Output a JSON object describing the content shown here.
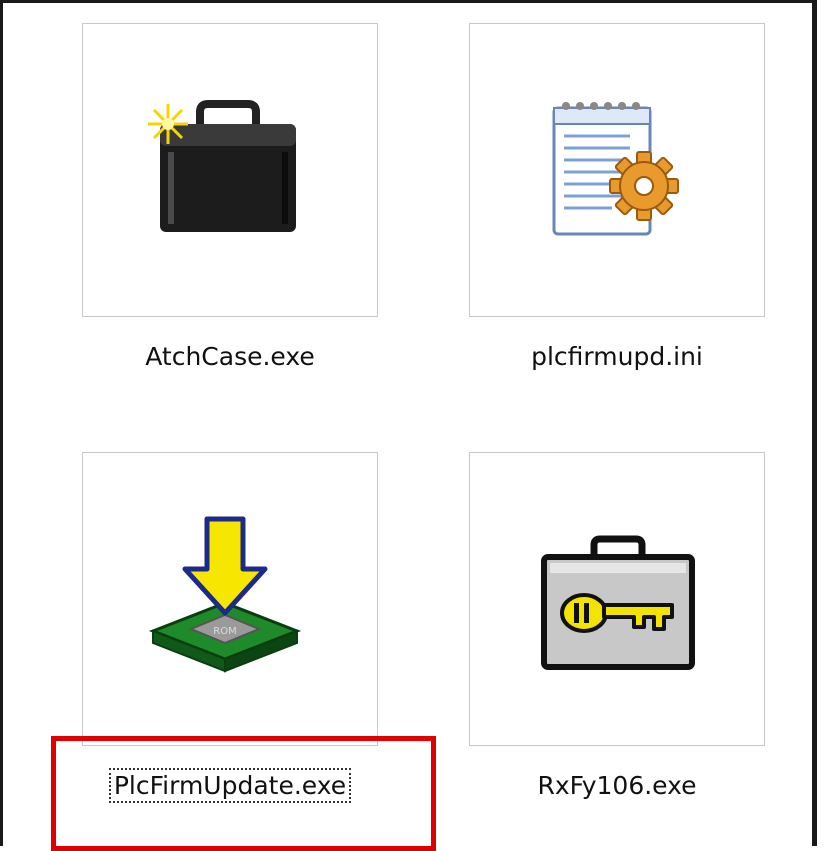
{
  "files": [
    {
      "name": "AtchCase.exe",
      "icon": "briefcase-icon",
      "selected": false
    },
    {
      "name": "plcfirmupd.ini",
      "icon": "config-file-icon",
      "selected": false
    },
    {
      "name": "PlcFirmUpdate.exe",
      "icon": "firmware-download-icon",
      "selected": true
    },
    {
      "name": "RxFy106.exe",
      "icon": "key-case-icon",
      "selected": false
    }
  ],
  "colors": {
    "highlight": "#e00000",
    "border": "#1a1a1a",
    "thumb_border": "#c8c8c8"
  }
}
